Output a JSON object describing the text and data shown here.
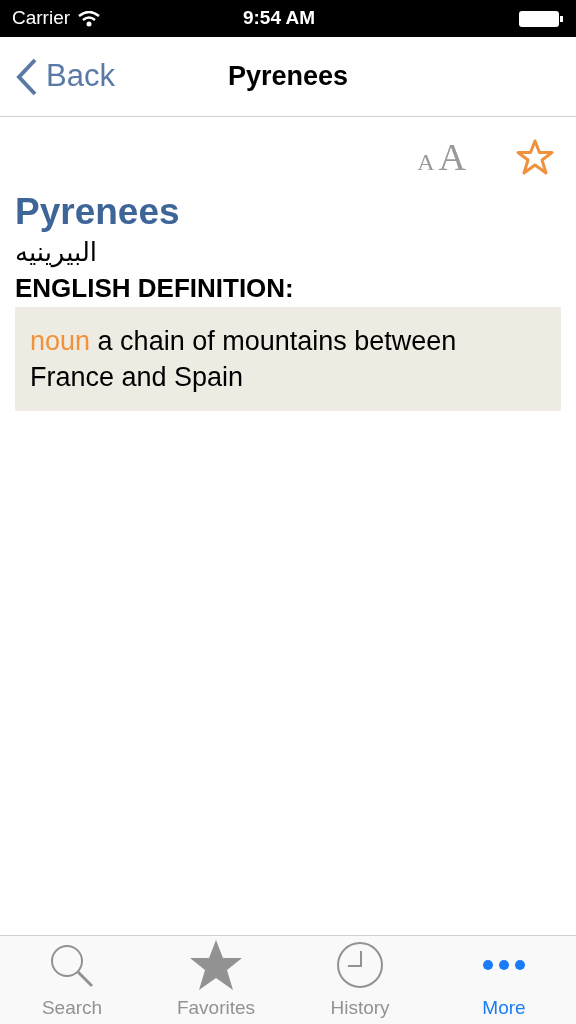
{
  "status_bar": {
    "carrier": "Carrier",
    "time": "9:54 AM"
  },
  "nav_bar": {
    "back": "Back",
    "title": "Pyrenees"
  },
  "toolbar": {
    "font_small": "A",
    "font_large": "A",
    "favorited": false
  },
  "entry": {
    "word": "Pyrenees",
    "translation": "البيرينيه",
    "heading": "ENGLISH DEFINITION:",
    "part_of_speech": "noun",
    "definition": "a chain of mountains between France and Spain"
  },
  "tabs": [
    {
      "kind": "search",
      "label": "Search",
      "selected": false
    },
    {
      "kind": "favorites",
      "label": "Favorites",
      "selected": false
    },
    {
      "kind": "history",
      "label": "History",
      "selected": false
    },
    {
      "kind": "more",
      "label": "More",
      "selected": true
    }
  ]
}
